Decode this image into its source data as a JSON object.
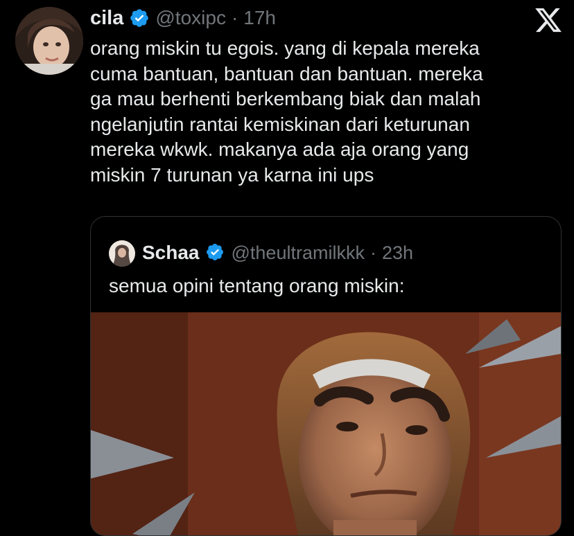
{
  "tweet": {
    "author_name": "cila",
    "handle": "@toxipc",
    "separator": "·",
    "time": "17h",
    "lines": [
      "orang miskin tu egois. yang di kepala mereka",
      "cuma bantuan, bantuan dan bantuan. mereka",
      "ga mau berhenti berkembang biak dan malah",
      "ngelanjutin rantai kemiskinan dari keturunan",
      "mereka wkwk. makanya ada aja orang yang",
      "miskin 7 turunan ya karna ini ups"
    ]
  },
  "quote": {
    "author_name": "Schaa",
    "handle": "@theultramilkkk",
    "separator": "·",
    "time": "23h",
    "text": "semua opini tentang orang miskin:"
  },
  "icons": {
    "brand": "x-logo-icon",
    "verified": "verified-badge-icon"
  },
  "colors": {
    "background": "#000000",
    "text": "#e7e9ea",
    "muted": "#71767b",
    "verified": "#1d9bf0",
    "border": "#2f3336"
  }
}
